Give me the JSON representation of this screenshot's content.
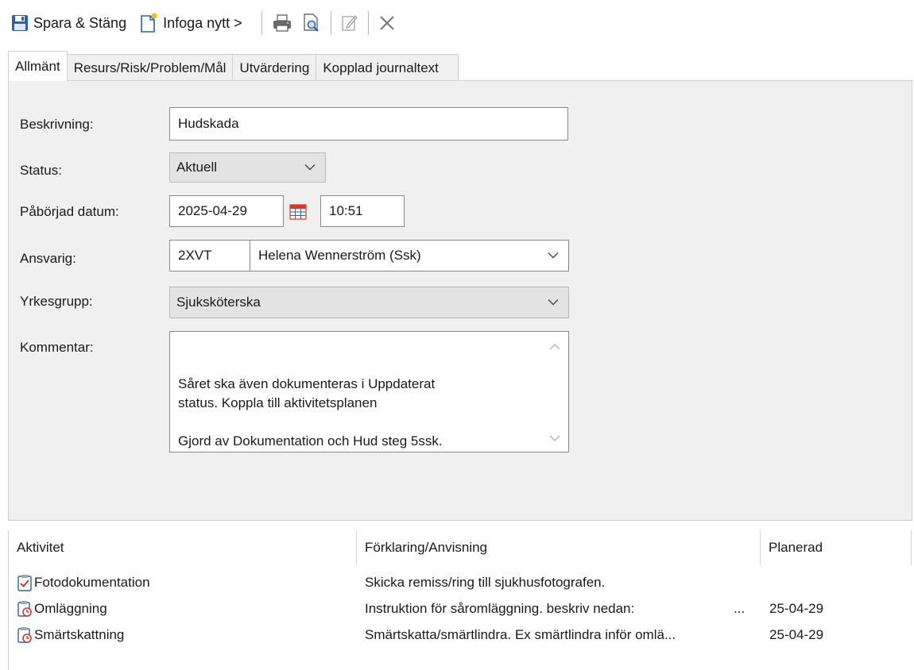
{
  "toolbar": {
    "save_close": "Spara & Stäng",
    "insert_new": "Infoga nytt >"
  },
  "tabs": [
    "Allmänt",
    "Resurs/Risk/Problem/Mål",
    "Utvärdering",
    "Kopplad journaltext"
  ],
  "form": {
    "beskrivning_label": "Beskrivning:",
    "beskrivning_value": "Hudskada",
    "status_label": "Status:",
    "status_value": "Aktuell",
    "start_label": "Påbörjad datum:",
    "start_date": "2025-04-29",
    "start_time": "10:51",
    "ansvarig_label": "Ansvarig:",
    "ansvarig_code": "2XVT",
    "ansvarig_name": "Helena Wennerström (Ssk)",
    "yrkesgrupp_label": "Yrkesgrupp:",
    "yrkesgrupp_value": "Sjuksköterska",
    "kommentar_label": "Kommentar:",
    "kommentar_value": "Såret ska även dokumenteras i Uppdaterat\nstatus. Koppla till aktivitetsplanen\n\nGjord av Dokumentation och Hud steg 5ssk."
  },
  "activities": {
    "headers": [
      "Aktivitet",
      "Förklaring/Anvisning",
      "Planerad"
    ],
    "rows": [
      {
        "name": "Fotodokumentation",
        "desc": "Skicka remiss/ring till sjukhusfotografen.",
        "more": "",
        "planned": "",
        "icon": "checklist-icon"
      },
      {
        "name": "Omläggning",
        "desc": "Instruktion för såromläggning. beskriv nedan:",
        "more": "...",
        "planned": "25-04-29",
        "icon": "clipboard-clock-icon"
      },
      {
        "name": "Smärtskattning",
        "desc": "Smärtskatta/smärtlindra. Ex smärtlindra inför omlä...",
        "more": "",
        "planned": "25-04-29",
        "icon": "clipboard-clock-icon"
      }
    ]
  },
  "colors": {
    "accent_blue": "#1f5fa8",
    "calendar_red": "#d23b2a"
  }
}
